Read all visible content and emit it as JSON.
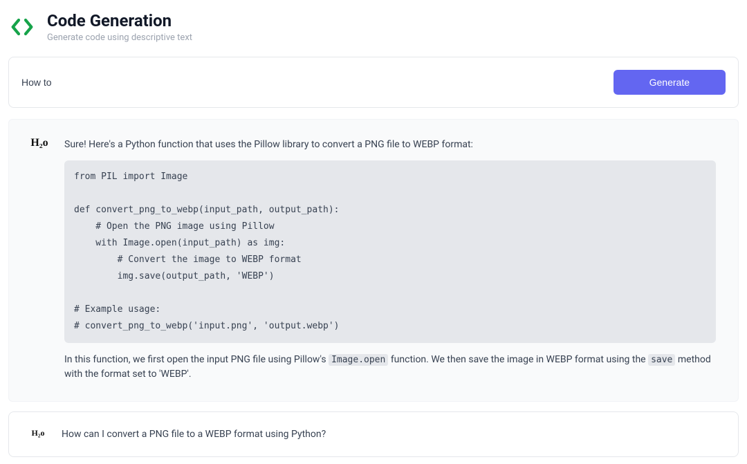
{
  "header": {
    "title": "Code Generation",
    "subtitle": "Generate code using descriptive text"
  },
  "input": {
    "value": "How to",
    "generate_label": "Generate"
  },
  "response": {
    "intro": "Sure! Here's a Python function that uses the Pillow library to convert a PNG file to WEBP format:",
    "code": "from PIL import Image\n\ndef convert_png_to_webp(input_path, output_path):\n    # Open the PNG image using Pillow\n    with Image.open(input_path) as img:\n        # Convert the image to WEBP format\n        img.save(output_path, 'WEBP')\n\n# Example usage:\n# convert_png_to_webp('input.png', 'output.webp')",
    "outro_pre": "In this function, we first open the input PNG file using Pillow's ",
    "outro_code1": "Image.open",
    "outro_mid": " function. We then save the image in WEBP format using the ",
    "outro_code2": "save",
    "outro_post": " method with the format set to 'WEBP'."
  },
  "history": {
    "prompt": "How can I convert a PNG file to a WEBP format using Python?"
  }
}
